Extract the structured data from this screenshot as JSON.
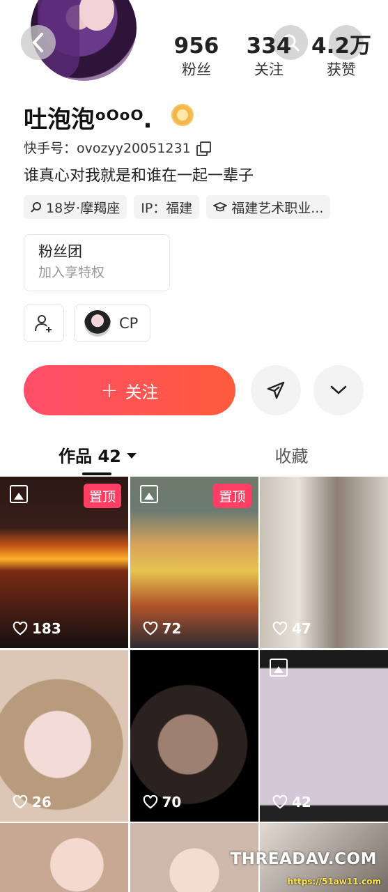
{
  "header": {
    "back_icon": "chevron-left-icon",
    "search_icon": "search-icon"
  },
  "stats": [
    {
      "value": "956",
      "label": "粉丝"
    },
    {
      "value": "334",
      "label": "关注"
    },
    {
      "value": "4.2万",
      "label": "获赞"
    }
  ],
  "profile": {
    "name": "吐泡泡ᵒᴼᵒᴼ.",
    "uid_label": "快手号：",
    "uid": "ovozyy20051231",
    "bio": "谁真心对我就是和谁在一起一辈子",
    "tags": [
      "18岁·摩羯座",
      "IP：福建",
      "福建艺术职业..."
    ]
  },
  "fanclub": {
    "title": "粉丝团",
    "subtitle": "加入享特权"
  },
  "cp_label": "CP",
  "actions": {
    "follow_label": "关注",
    "follow_color": "#fe4a5e"
  },
  "tabs": [
    {
      "label": "作品 42"
    },
    {
      "label": "收藏"
    }
  ],
  "posts": [
    {
      "likes": "183",
      "pinned": "置顶"
    },
    {
      "likes": "72",
      "pinned": "置顶"
    },
    {
      "likes": "47"
    },
    {
      "likes": "26"
    },
    {
      "likes": "70"
    },
    {
      "likes": "42"
    }
  ],
  "watermark": {
    "main": "THREADAV.COM",
    "sub": "https://51aw11.com"
  }
}
